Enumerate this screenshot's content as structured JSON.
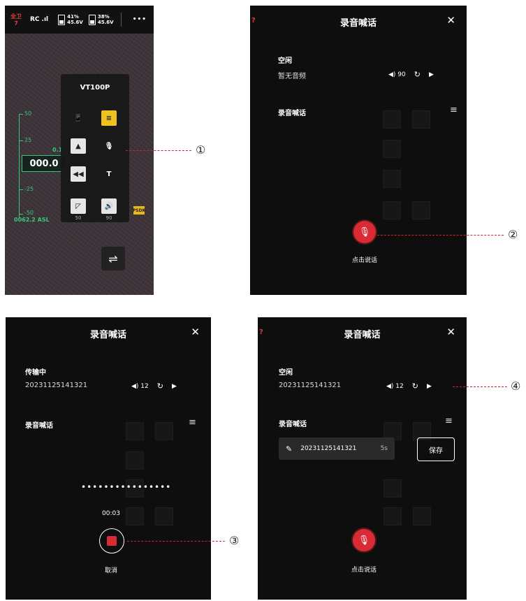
{
  "feed": {
    "status_top": "全卫",
    "status_bottom": "7",
    "rc": "RC",
    "signal": ".ıl",
    "battery1_pct": "41%",
    "battery1_v": "45.6V",
    "battery2_pct": "38%",
    "battery2_v": "45.6V",
    "more": "•••",
    "tick_50": "50",
    "tick_25": "25",
    "tick_neg25": "-25",
    "tick_neg50": "-50",
    "speed": "0.1",
    "altitude": "000.0",
    "asl": "0062.2 ASL",
    "popup_title": "VT100P",
    "vol_left_value": "50",
    "vol_right_value": "90",
    "psdk": "PSDK",
    "swap_icon": "⇌"
  },
  "voice": {
    "title": "录音喊话",
    "close": "✕",
    "section": "录音喊话",
    "talk_label": "点击说话",
    "cancel_label": "取消",
    "save_label": "保存",
    "panel2": {
      "status": "空闲",
      "file": "暂无音频",
      "volume": "90"
    },
    "panel3": {
      "status": "传输中",
      "file": "20231125141321",
      "volume": "12",
      "dots": "••••••••••••••••",
      "timer": "00:03"
    },
    "panel4": {
      "status": "空闲",
      "file": "20231125141321",
      "volume": "12",
      "record_name": "20231125141321",
      "record_duration": "5s"
    }
  },
  "annotations": {
    "n1": "①",
    "n2": "②",
    "n3": "③",
    "n4": "④"
  },
  "colors": {
    "accent_red": "#d82b35",
    "gauge_green": "#38c77a",
    "highlight_yellow": "#f0c21f"
  }
}
